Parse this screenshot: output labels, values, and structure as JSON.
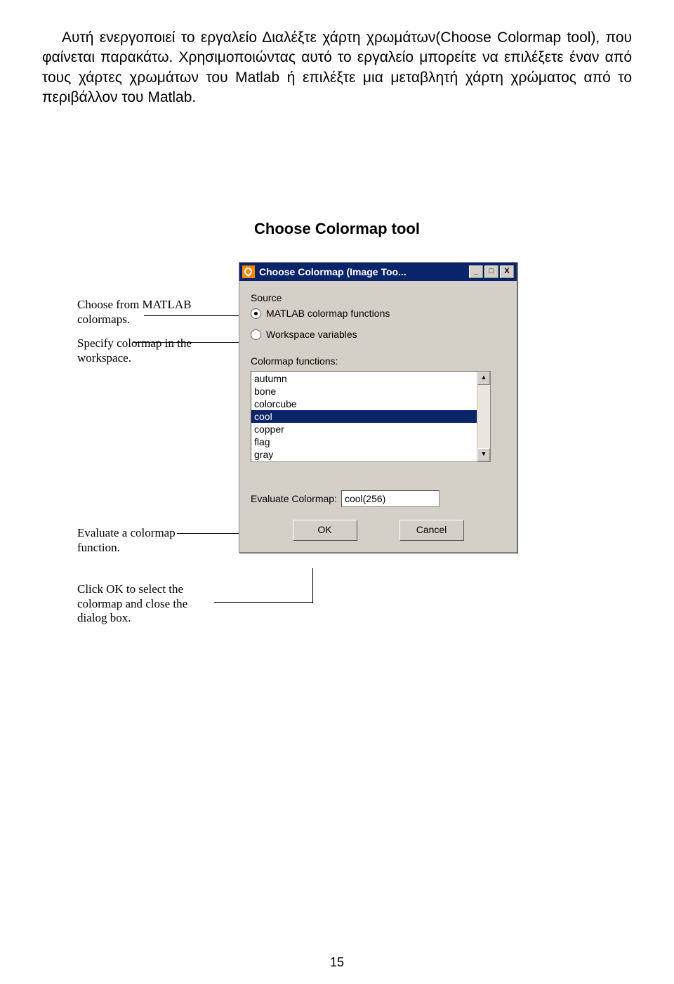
{
  "para_text": "Αυτή ενεργοποιεί το εργαλείο Διαλέξτε χάρτη χρωμάτων(Choose Colormap tool), που φαίνεται παρακάτω. Χρησιμοποιώντας αυτό το εργαλείο μπορείτε να επιλέξετε έναν από τους χάρτες χρωμάτων του Matlab ή επιλέξτε μια μεταβλητή χάρτη χρώματος  από το περιβάλλον του Matlab.",
  "section_title": "Choose Colormap tool",
  "annotations": {
    "a1": "Choose from MATLAB colormaps.",
    "a2": "Specify colormap in the workspace.",
    "a3": "Evaluate a colormap function.",
    "a4": "Click OK to select the colormap and close the dialog box."
  },
  "dialog": {
    "title": "Choose Colormap (Image Too...",
    "source_label": "Source",
    "radio1": "MATLAB colormap functions",
    "radio2": "Workspace variables",
    "list_label": "Colormap functions:",
    "items": [
      "autumn",
      "bone",
      "colorcube",
      "cool",
      "copper",
      "flag",
      "gray"
    ],
    "selected_item": "cool",
    "eval_label": "Evaluate Colormap:",
    "eval_value": "cool(256)",
    "ok": "OK",
    "cancel": "Cancel",
    "btn_min": "_",
    "btn_max": "□",
    "btn_close": "X"
  },
  "page_number": "15"
}
